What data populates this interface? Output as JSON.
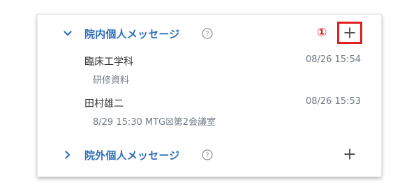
{
  "sections": [
    {
      "title": "院内個人メッセージ",
      "expanded": true,
      "messages": [
        {
          "sender": "臨床工学科",
          "time": "08/26 15:54",
          "preview": "研修資料"
        },
        {
          "sender": "田村雄二",
          "time": "08/26 15:53",
          "preview": "8/29 15:30 MTG☒第2会議室"
        }
      ]
    },
    {
      "title": "院外個人メッセージ",
      "expanded": false,
      "messages": []
    }
  ],
  "annotation": {
    "marker": "①"
  },
  "colors": {
    "accent": "#2f6fb8",
    "muted_text": "#707a86",
    "annotation_red": "#e02020"
  }
}
